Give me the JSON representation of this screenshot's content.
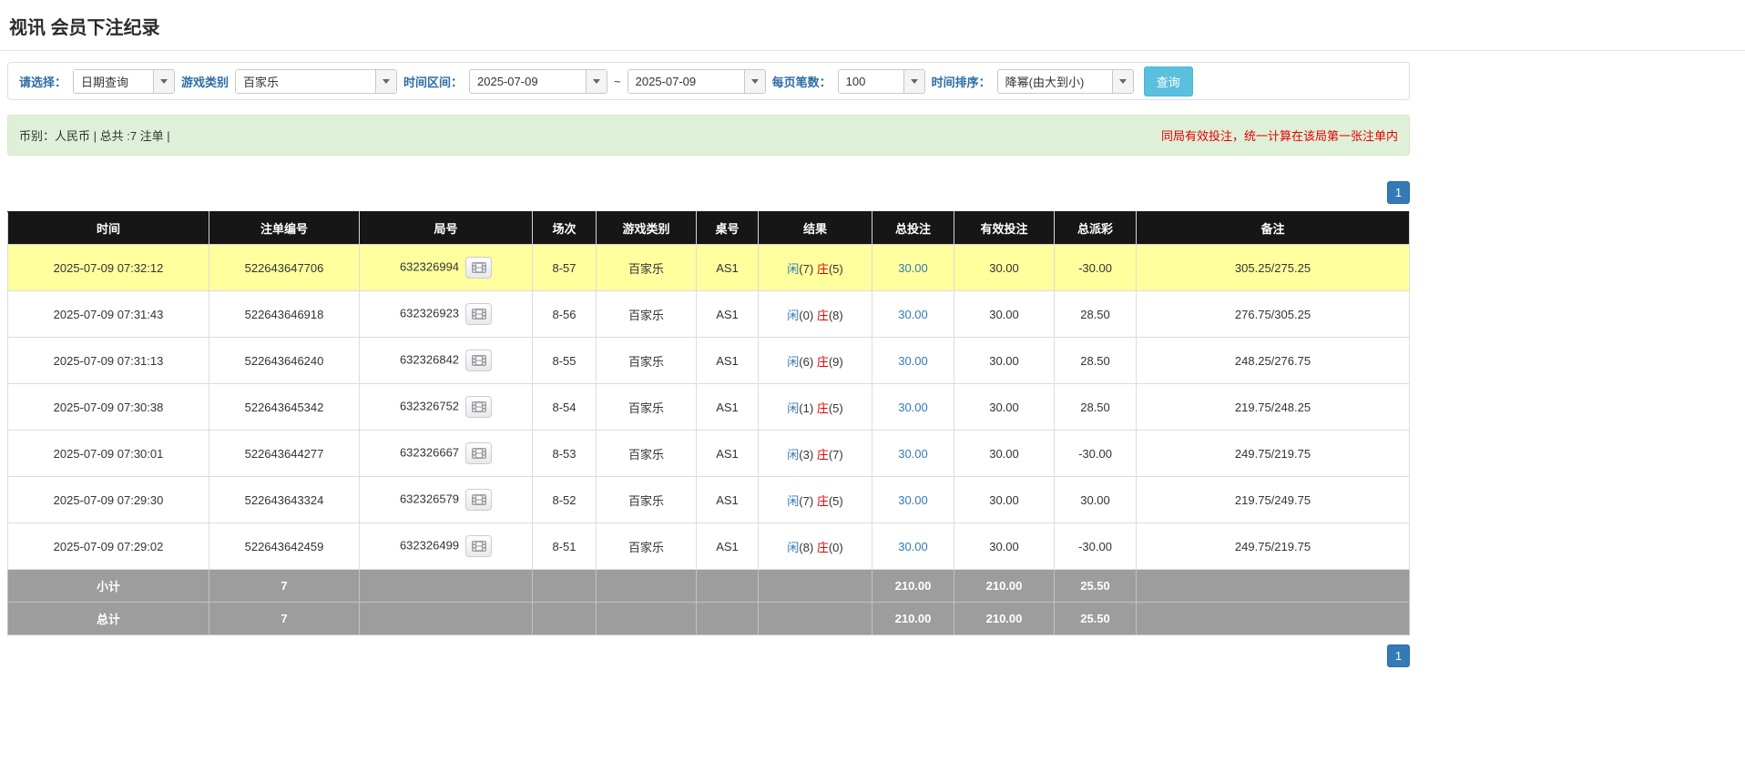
{
  "page_title": "视讯 会员下注纪录",
  "filters": {
    "select_label": "请选择：",
    "select_value": "日期查询",
    "game_type_label": "游戏类别",
    "game_type_value": "百家乐",
    "time_range_label": "时间区间：",
    "time_from": "2025-07-09",
    "time_separator": "~",
    "time_to": "2025-07-09",
    "page_size_label": "每页笔数：",
    "page_size_value": "100",
    "sort_label": "时间排序：",
    "sort_value": "降幂(由大到小)",
    "search_button_label": "查询"
  },
  "summary": {
    "left_text": "币别：人民币 | 总共 :7 注单 |",
    "right_text": "同局有效投注，统一计算在该局第一张注单内"
  },
  "pagination": {
    "current_page": "1"
  },
  "colors": {
    "accent_blue": "#337ab7",
    "banker_red": "#e60000",
    "negative_red": "#e60000",
    "highlight_yellow": "#ffff9e",
    "header_black": "#161616",
    "footer_gray": "#9d9d9d",
    "summary_green_bg": "#dff0d8",
    "search_button_blue": "#5bc0de"
  },
  "table": {
    "headers": [
      "时间",
      "注单编号",
      "局号",
      "场次",
      "游戏类别",
      "桌号",
      "结果",
      "总投注",
      "有效投注",
      "总派彩",
      "备注"
    ],
    "video_icon": "video-replay-icon",
    "rows": [
      {
        "time": "2025-07-09 07:32:12",
        "order_id": "522643647706",
        "round_id": "632326994",
        "session": "8-57",
        "game_type": "百家乐",
        "table_id": "AS1",
        "player_label": "闲",
        "player_score": "(7)",
        "banker_label": "庄",
        "banker_score": "(5)",
        "total_bet": "30.00",
        "valid_bet": "30.00",
        "payout": "-30.00",
        "payout_negative": true,
        "remark": "305.25/275.25",
        "highlighted": true
      },
      {
        "time": "2025-07-09 07:31:43",
        "order_id": "522643646918",
        "round_id": "632326923",
        "session": "8-56",
        "game_type": "百家乐",
        "table_id": "AS1",
        "player_label": "闲",
        "player_score": "(0)",
        "banker_label": "庄",
        "banker_score": "(8)",
        "total_bet": "30.00",
        "valid_bet": "30.00",
        "payout": "28.50",
        "payout_negative": false,
        "remark": "276.75/305.25",
        "highlighted": false
      },
      {
        "time": "2025-07-09 07:31:13",
        "order_id": "522643646240",
        "round_id": "632326842",
        "session": "8-55",
        "game_type": "百家乐",
        "table_id": "AS1",
        "player_label": "闲",
        "player_score": "(6)",
        "banker_label": "庄",
        "banker_score": "(9)",
        "total_bet": "30.00",
        "valid_bet": "30.00",
        "payout": "28.50",
        "payout_negative": false,
        "remark": "248.25/276.75",
        "highlighted": false
      },
      {
        "time": "2025-07-09 07:30:38",
        "order_id": "522643645342",
        "round_id": "632326752",
        "session": "8-54",
        "game_type": "百家乐",
        "table_id": "AS1",
        "player_label": "闲",
        "player_score": "(1)",
        "banker_label": "庄",
        "banker_score": "(5)",
        "total_bet": "30.00",
        "valid_bet": "30.00",
        "payout": "28.50",
        "payout_negative": false,
        "remark": "219.75/248.25",
        "highlighted": false
      },
      {
        "time": "2025-07-09 07:30:01",
        "order_id": "522643644277",
        "round_id": "632326667",
        "session": "8-53",
        "game_type": "百家乐",
        "table_id": "AS1",
        "player_label": "闲",
        "player_score": "(3)",
        "banker_label": "庄",
        "banker_score": "(7)",
        "total_bet": "30.00",
        "valid_bet": "30.00",
        "payout": "-30.00",
        "payout_negative": true,
        "remark": "249.75/219.75",
        "highlighted": false
      },
      {
        "time": "2025-07-09 07:29:30",
        "order_id": "522643643324",
        "round_id": "632326579",
        "session": "8-52",
        "game_type": "百家乐",
        "table_id": "AS1",
        "player_label": "闲",
        "player_score": "(7)",
        "banker_label": "庄",
        "banker_score": "(5)",
        "total_bet": "30.00",
        "valid_bet": "30.00",
        "payout": "30.00",
        "payout_negative": false,
        "remark": "219.75/249.75",
        "highlighted": false
      },
      {
        "time": "2025-07-09 07:29:02",
        "order_id": "522643642459",
        "round_id": "632326499",
        "session": "8-51",
        "game_type": "百家乐",
        "table_id": "AS1",
        "player_label": "闲",
        "player_score": "(8)",
        "banker_label": "庄",
        "banker_score": "(0)",
        "total_bet": "30.00",
        "valid_bet": "30.00",
        "payout": "-30.00",
        "payout_negative": true,
        "remark": "249.75/219.75",
        "highlighted": false
      }
    ],
    "subtotal_row": {
      "label": "小计",
      "count": "7",
      "total_bet": "210.00",
      "valid_bet": "210.00",
      "payout": "25.50"
    },
    "total_row": {
      "label": "总计",
      "count": "7",
      "total_bet": "210.00",
      "valid_bet": "210.00",
      "payout": "25.50"
    }
  }
}
